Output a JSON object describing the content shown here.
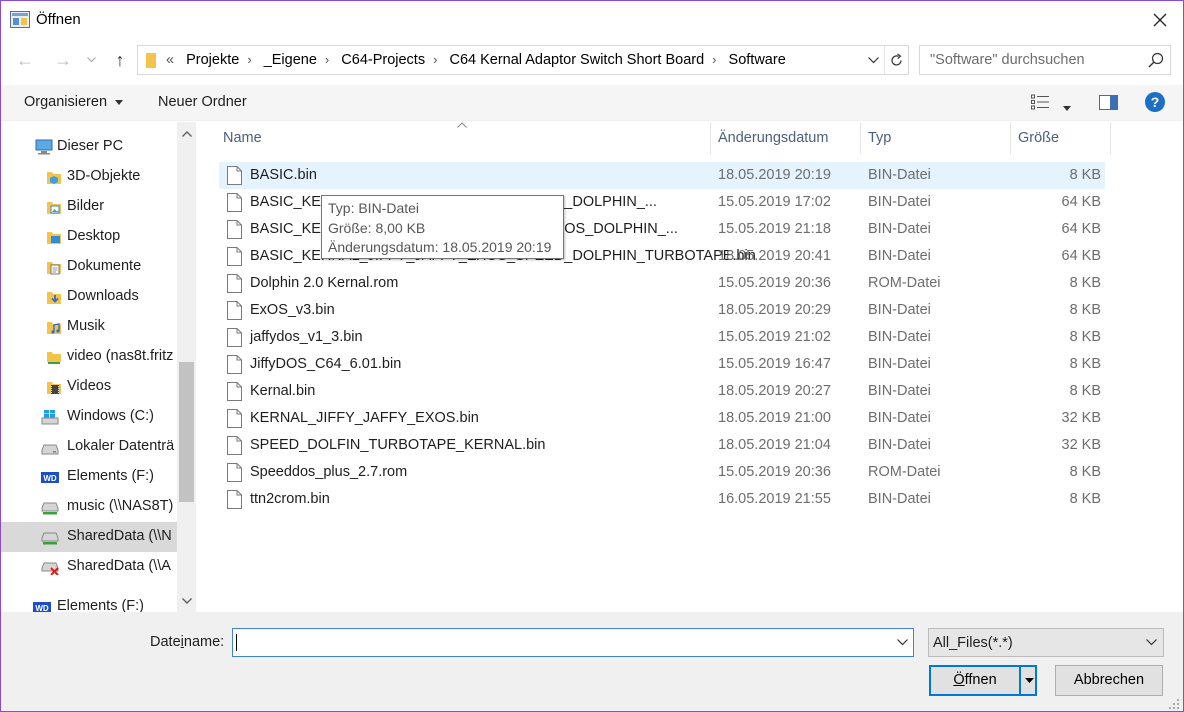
{
  "window": {
    "title": "Öffnen"
  },
  "address": {
    "back_arrow": "←",
    "forward_arrow": "→",
    "up_arrow": "↑",
    "prefix": "«",
    "crumbs": [
      "Projekte",
      "_Eigene",
      "C64-Projects",
      "C64 Kernal Adaptor Switch Short Board",
      "Software"
    ]
  },
  "search": {
    "placeholder": "\"Software\" durchsuchen"
  },
  "toolbar": {
    "organize_label": "Organisieren",
    "new_folder_label": "Neuer Ordner",
    "help_label": "?"
  },
  "sidebar": {
    "items": [
      {
        "label": "Dieser PC",
        "icon": "computer-icon"
      },
      {
        "label": "3D-Objekte",
        "icon": "3d-objects-icon"
      },
      {
        "label": "Bilder",
        "icon": "pictures-icon"
      },
      {
        "label": "Desktop",
        "icon": "desktop-icon"
      },
      {
        "label": "Dokumente",
        "icon": "documents-icon"
      },
      {
        "label": "Downloads",
        "icon": "downloads-icon"
      },
      {
        "label": "Musik",
        "icon": "music-icon"
      },
      {
        "label": "video (nas8t.fritz",
        "icon": "network-folder-icon"
      },
      {
        "label": "Videos",
        "icon": "videos-icon"
      },
      {
        "label": "Windows (C:)",
        "icon": "windows-drive-icon"
      },
      {
        "label": "Lokaler Datenträ",
        "icon": "drive-icon"
      },
      {
        "label": "Elements (F:)",
        "icon": "wd-drive-icon"
      },
      {
        "label": "music (\\\\NAS8T)",
        "icon": "network-drive-icon"
      },
      {
        "label": "SharedData (\\\\N",
        "icon": "network-drive-icon"
      },
      {
        "label": "SharedData (\\\\A",
        "icon": "disconnected-drive-icon"
      },
      {
        "label": "Elements (F:)",
        "icon": "wd-drive-icon"
      }
    ]
  },
  "columns": {
    "name": "Name",
    "date": "Änderungsdatum",
    "type": "Typ",
    "size": "Größe"
  },
  "files": [
    {
      "name": "BASIC.bin",
      "date": "18.05.2019 20:19",
      "type": "BIN-Datei",
      "size": "8 KB"
    },
    {
      "name": "BASIC_KERNAL_JIFFY_JAFFY_EXOS_SPEED_DOLPHIN_...",
      "date": "15.05.2019 17:02",
      "type": "BIN-Datei",
      "size": "64 KB"
    },
    {
      "name": "BASIC_KERNAL_JIFFY_JAFFY_EXOS_JIFFYDOS_DOLPHIN_...",
      "date": "15.05.2019 21:18",
      "type": "BIN-Datei",
      "size": "64 KB"
    },
    {
      "name": "BASIC_KERNAL_JIFFY_JAFFY_EXOS_SPEED_DOLPHIN_TURBOTAPE.bin",
      "date": "18.05.2019 20:41",
      "type": "BIN-Datei",
      "size": "64 KB"
    },
    {
      "name": "Dolphin 2.0 Kernal.rom",
      "date": "15.05.2019 20:36",
      "type": "ROM-Datei",
      "size": "8 KB"
    },
    {
      "name": "ExOS_v3.bin",
      "date": "18.05.2019 20:29",
      "type": "BIN-Datei",
      "size": "8 KB"
    },
    {
      "name": "jaffydos_v1_3.bin",
      "date": "15.05.2019 21:02",
      "type": "BIN-Datei",
      "size": "8 KB"
    },
    {
      "name": "JiffyDOS_C64_6.01.bin",
      "date": "15.05.2019 16:47",
      "type": "BIN-Datei",
      "size": "8 KB"
    },
    {
      "name": "Kernal.bin",
      "date": "18.05.2019 20:27",
      "type": "BIN-Datei",
      "size": "8 KB"
    },
    {
      "name": "KERNAL_JIFFY_JAFFY_EXOS.bin",
      "date": "18.05.2019 21:00",
      "type": "BIN-Datei",
      "size": "32 KB"
    },
    {
      "name": "SPEED_DOLFIN_TURBOTAPE_KERNAL.bin",
      "date": "18.05.2019 21:04",
      "type": "BIN-Datei",
      "size": "32 KB"
    },
    {
      "name": "Speeddos_plus_2.7.rom",
      "date": "15.05.2019 20:36",
      "type": "ROM-Datei",
      "size": "8 KB"
    },
    {
      "name": "ttn2crom.bin",
      "date": "16.05.2019 21:55",
      "type": "BIN-Datei",
      "size": "8 KB"
    }
  ],
  "tooltip": {
    "type_line": "Typ: BIN-Datei",
    "size_line": "Größe: 8,00 KB",
    "date_line": "Änderungsdatum: 18.05.2019 20:19"
  },
  "bottom": {
    "filename_label_pre": "Date",
    "filename_label_ul": "i",
    "filename_label_post": "name:",
    "filename_value": "",
    "filetype_selected": "All_Files(*.*)",
    "open_label_pre": "",
    "open_label_ul": "Ö",
    "open_label_post": "ffnen",
    "cancel_label": "Abbrechen"
  },
  "colors": {
    "accent": "#0078d7",
    "hover_row": "#e5f3ff",
    "folder": "#f3c34c",
    "help_blue": "#1e6fc4"
  }
}
